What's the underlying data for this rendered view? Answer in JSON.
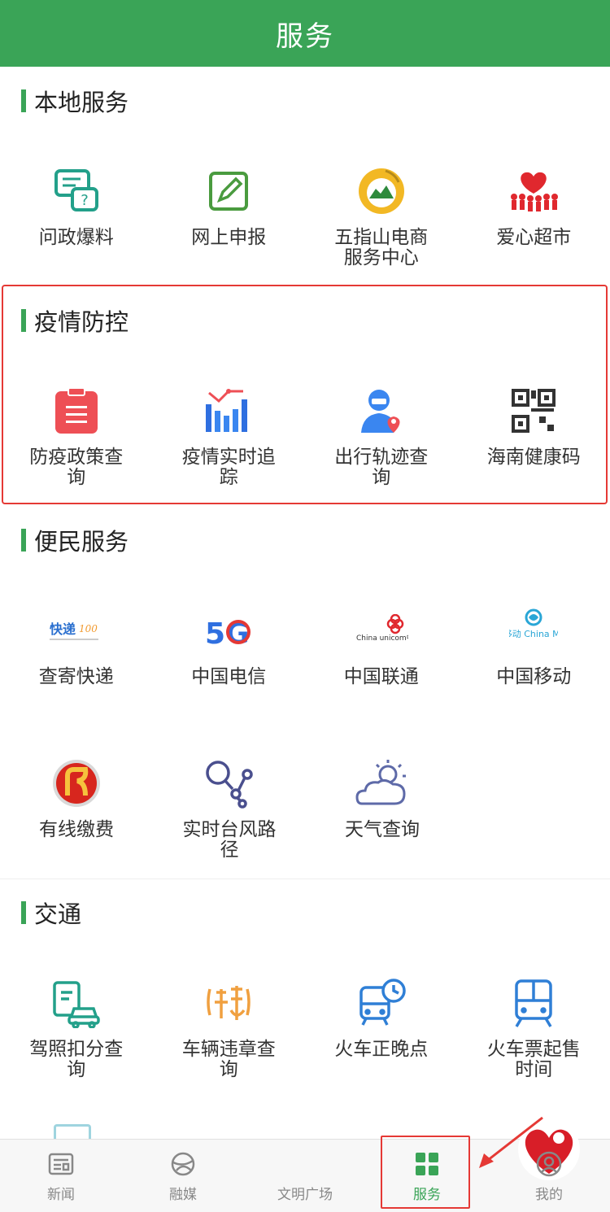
{
  "header": {
    "title": "服务"
  },
  "sections": [
    {
      "title": "本地服务",
      "items": [
        {
          "label": "问政爆料",
          "icon": "chat-question-icon"
        },
        {
          "label": "网上申报",
          "icon": "edit-pen-icon"
        },
        {
          "label": "五指山电商服务中心",
          "icon": "mountain-logo-icon"
        },
        {
          "label": "爱心超市",
          "icon": "heart-people-icon"
        }
      ]
    },
    {
      "title": "疫情防控",
      "items": [
        {
          "label": "防疫政策查询",
          "icon": "clipboard-icon"
        },
        {
          "label": "疫情实时追踪",
          "icon": "bar-trend-icon"
        },
        {
          "label": "出行轨迹查询",
          "icon": "person-location-icon"
        },
        {
          "label": "海南健康码",
          "icon": "qr-code-icon"
        }
      ]
    },
    {
      "title": "便民服务",
      "items": [
        {
          "label": "查寄快递",
          "icon": "express-logo-icon"
        },
        {
          "label": "中国电信",
          "icon": "telecom-5g-icon"
        },
        {
          "label": "中国联通",
          "icon": "unicom-logo-icon"
        },
        {
          "label": "中国移动",
          "icon": "mobile-logo-icon"
        },
        {
          "label": "有线缴费",
          "icon": "cable-logo-icon"
        },
        {
          "label": "实时台风路径",
          "icon": "typhoon-path-icon"
        },
        {
          "label": "天气查询",
          "icon": "weather-icon"
        }
      ]
    },
    {
      "title": "交通",
      "items": [
        {
          "label": "驾照扣分查询",
          "icon": "license-car-icon"
        },
        {
          "label": "车辆违章查询",
          "icon": "violation-icon"
        },
        {
          "label": "火车正晚点",
          "icon": "train-clock-icon"
        },
        {
          "label": "火车票起售时间",
          "icon": "train-icon"
        }
      ]
    }
  ],
  "tabbar": [
    {
      "label": "新闻",
      "icon": "news-icon",
      "active": false
    },
    {
      "label": "融媒",
      "icon": "globe-icon",
      "active": false
    },
    {
      "label": "文明广场",
      "icon": "heart-logo-icon",
      "active": false
    },
    {
      "label": "服务",
      "icon": "grid-icon",
      "active": true
    },
    {
      "label": "我的",
      "icon": "user-icon",
      "active": false
    }
  ],
  "colors": {
    "brand": "#3aa457",
    "highlight": "#e53935"
  },
  "logo_text": {
    "express": "快递",
    "telecom": "5G",
    "unicom": "China unicom中国联通",
    "mobile": "中国移动 China Mobile"
  }
}
